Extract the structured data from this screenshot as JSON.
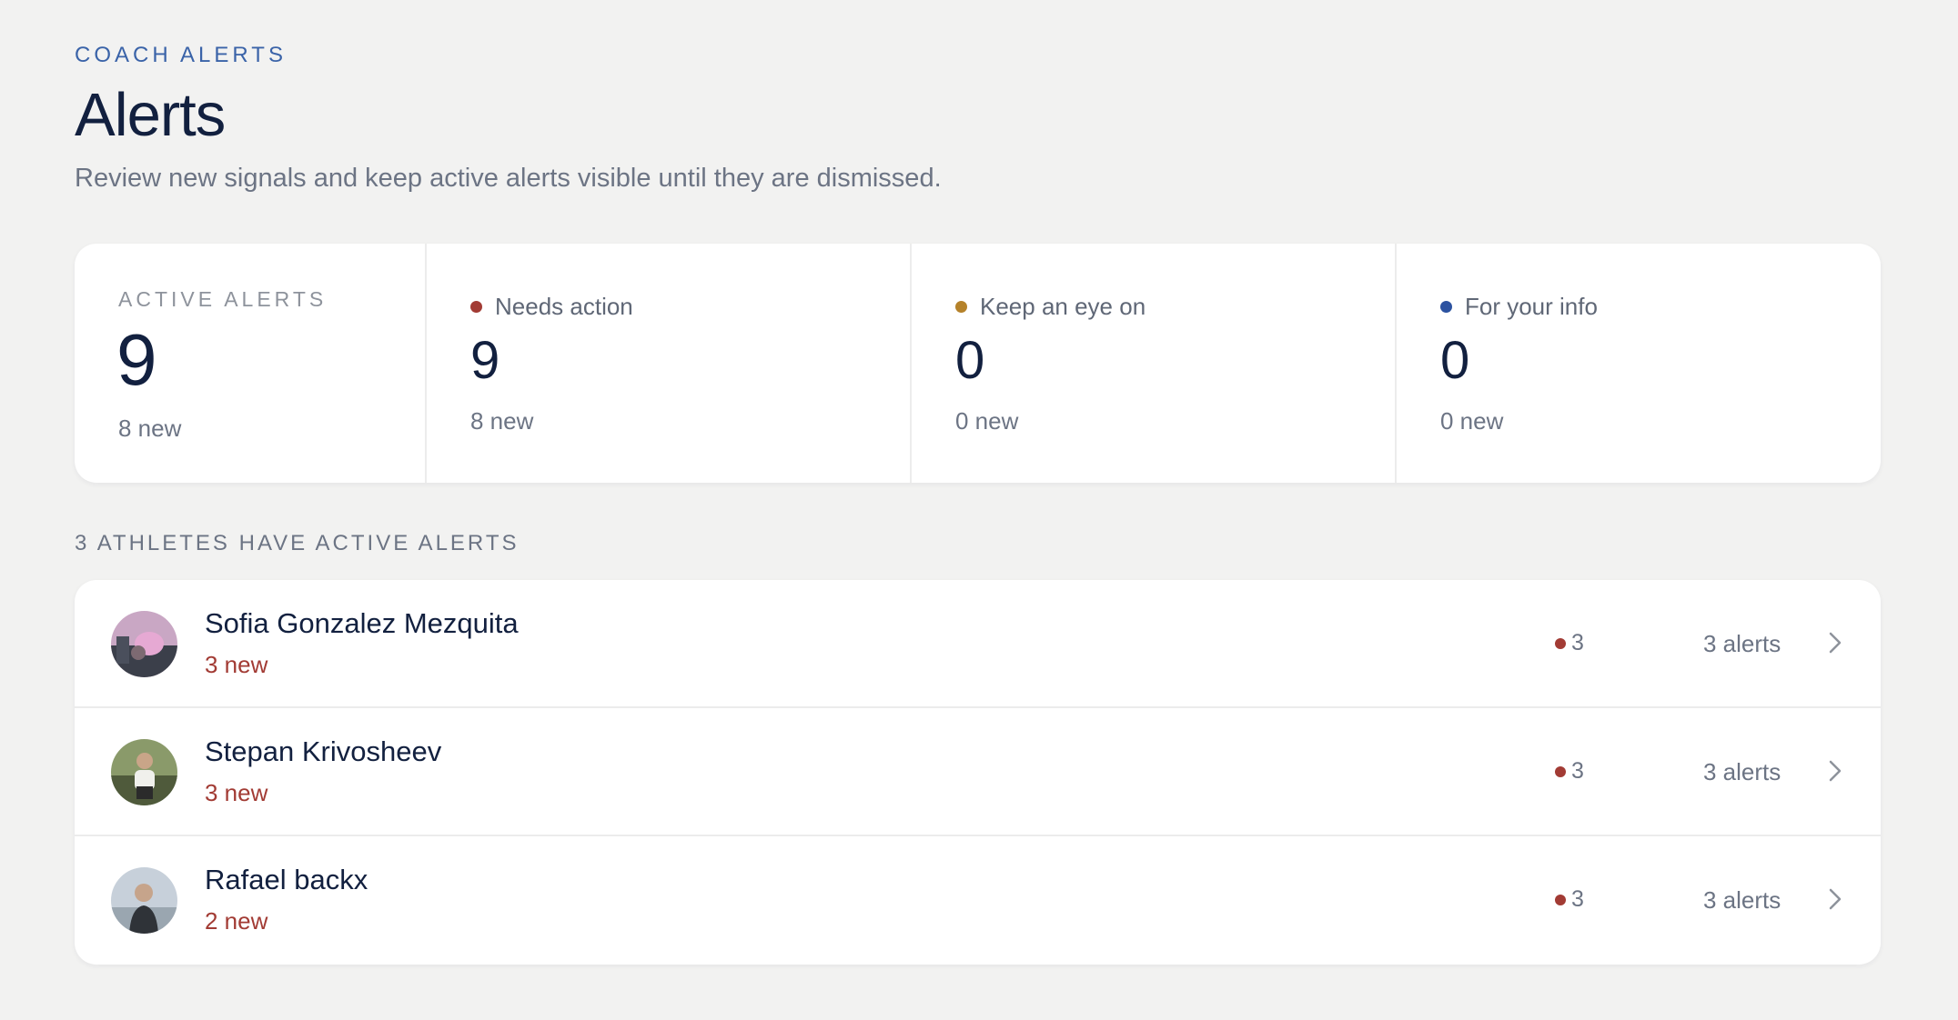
{
  "header": {
    "eyebrow": "COACH ALERTS",
    "title": "Alerts",
    "subtitle": "Review new signals and keep active alerts visible until they are dismissed."
  },
  "summary": {
    "total": {
      "label": "ACTIVE ALERTS",
      "value": "9",
      "new": "8 new"
    },
    "categories": [
      {
        "label": "Needs action",
        "value": "9",
        "new": "8 new",
        "color": "#a23b34"
      },
      {
        "label": "Keep an eye on",
        "value": "0",
        "new": "0 new",
        "color": "#b5822a"
      },
      {
        "label": "For your info",
        "value": "0",
        "new": "0 new",
        "color": "#2c52a0"
      }
    ]
  },
  "athletes_section": {
    "label": "3 ATHLETES HAVE ACTIVE ALERTS",
    "rows": [
      {
        "name": "Sofia Gonzalez Mezquita",
        "new": "3 new",
        "badge_count": "3",
        "alerts": "3 alerts"
      },
      {
        "name": "Stepan Krivosheev",
        "new": "3 new",
        "badge_count": "3",
        "alerts": "3 alerts"
      },
      {
        "name": "Rafael backx",
        "new": "2 new",
        "badge_count": "3",
        "alerts": "3 alerts"
      }
    ]
  },
  "colors": {
    "accent": "#3a63a8",
    "needs_action": "#a23b34",
    "keep_eye": "#b5822a",
    "info": "#2c52a0"
  }
}
